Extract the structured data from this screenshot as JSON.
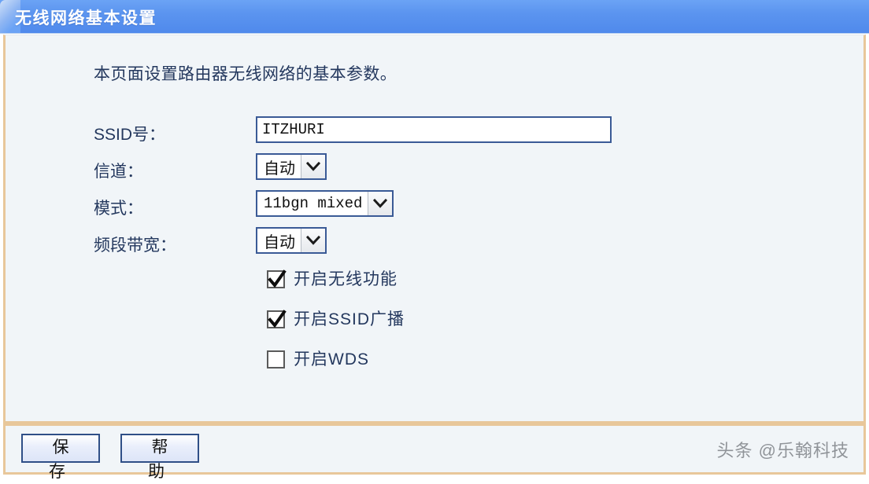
{
  "window": {
    "title": "无线网络基本设置",
    "accent_color": "#5b94ef",
    "panel_border_color": "#e8c79a",
    "panel_background": "#f1f5f8",
    "text_color": "#24385e"
  },
  "main": {
    "intro": "本页面设置路由器无线网络的基本参数。",
    "fields": [
      {
        "label": "SSID号：",
        "type": "text",
        "value": "ITZHURI"
      },
      {
        "label": "信道：",
        "type": "select",
        "value": "自动"
      },
      {
        "label": "模式：",
        "type": "select",
        "value": "11bgn mixed"
      },
      {
        "label": "频段带宽：",
        "type": "select",
        "value": "自动"
      }
    ],
    "checkboxes": [
      {
        "label": "开启无线功能",
        "checked": true
      },
      {
        "label": "开启SSID广播",
        "checked": true
      },
      {
        "label": "开启WDS",
        "checked": false
      }
    ]
  },
  "footer": {
    "save_label": "保 存",
    "help_label": "帮 助",
    "watermark": "头条 @乐翰科技"
  }
}
